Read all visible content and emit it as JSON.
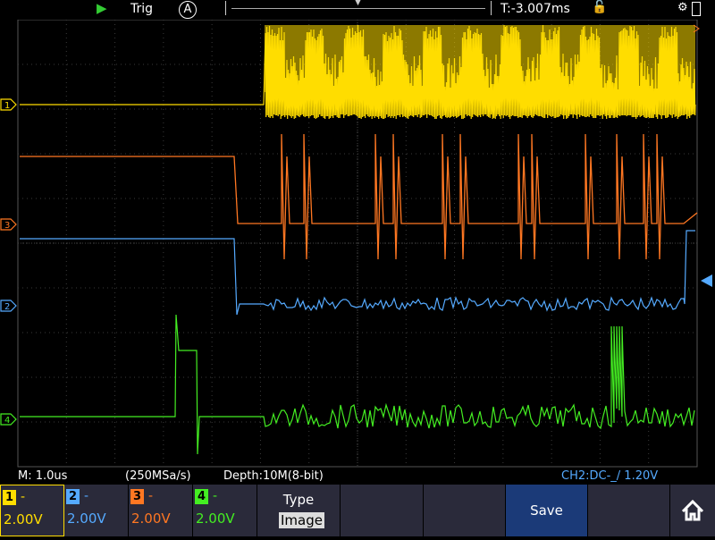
{
  "top": {
    "trig_label": "Trig",
    "trig_mode": "A",
    "time_offset": "T:-3.007ms"
  },
  "info": {
    "timebase": "M: 1.0us",
    "sample_rate": "(250MSa/s)",
    "depth": "Depth:10M(8-bit)",
    "trigger": "CH2:DC-_/ 1.20V"
  },
  "channels": [
    {
      "num": "1",
      "dash": "-",
      "volts": "2.00V",
      "color": "#ffdd00"
    },
    {
      "num": "2",
      "dash": "-",
      "volts": "2.00V",
      "color": "#55aaff"
    },
    {
      "num": "3",
      "dash": "-",
      "volts": "2.00V",
      "color": "#ff7722"
    },
    {
      "num": "4",
      "dash": "-",
      "volts": "2.00V",
      "color": "#44ee22"
    }
  ],
  "softkeys": {
    "type_label": "Type",
    "type_value": "Image",
    "save_label": "Save"
  },
  "colors": {
    "grid": "#3a3a3a",
    "softkey_bg": "#2a2a3a",
    "save_bg": "#1b3a78"
  }
}
